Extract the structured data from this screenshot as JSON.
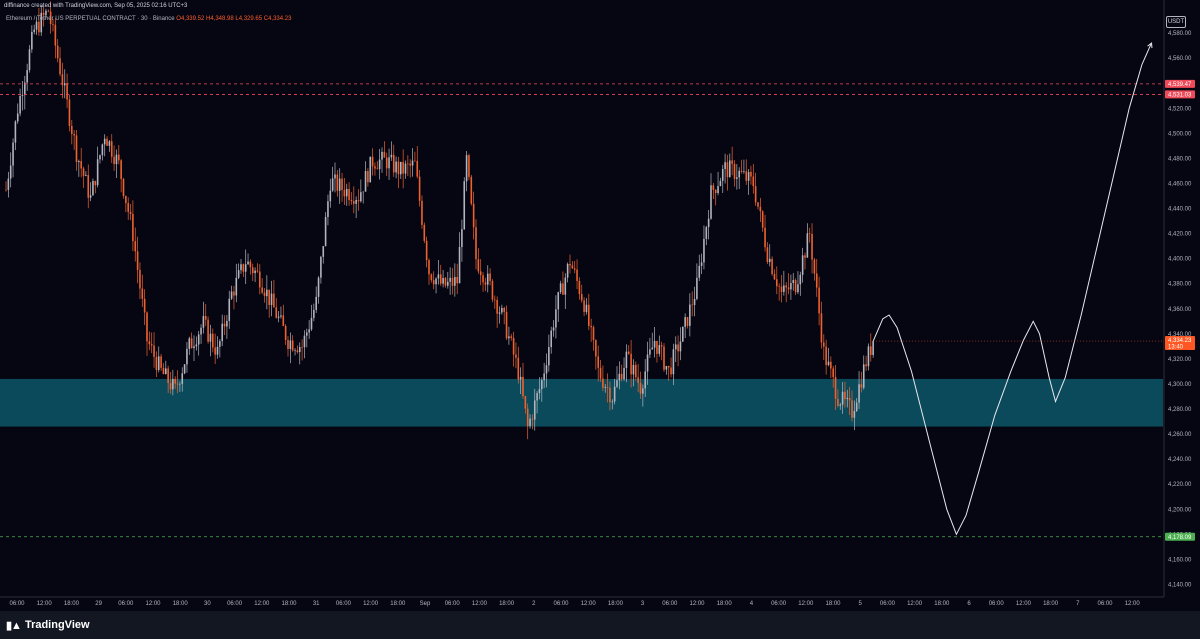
{
  "header": {
    "title": "diffinance created with TradingView.com, Sep 05, 2025 02:16 UTC+3",
    "symbol": "Ethereum / Tether US PERPETUAL CONTRACT · 30 · Binance",
    "ohlc_o": "O4,339.52",
    "ohlc_h": "H4,348.98",
    "ohlc_l": "L4,329.65",
    "ohlc_c": "C4,334.23",
    "unit": "USDT"
  },
  "brand": {
    "name": "TradingView",
    "logo_icon": "tradingview-logo-icon"
  },
  "colors": {
    "background": "#060613",
    "up": "#b2b5be",
    "down": "#f0622d",
    "zone": "#0a4a5a",
    "resistance": "#ef4a5a",
    "support": "#4caf50",
    "price": "#ff5722"
  },
  "chart_data": {
    "type": "bar",
    "ylim": [
      4130,
      4600
    ],
    "y_ticks": [
      4140,
      4160,
      4180,
      4200,
      4220,
      4240,
      4260,
      4280,
      4300,
      4320,
      4340,
      4360,
      4380,
      4400,
      4420,
      4440,
      4460,
      4480,
      4500,
      4520,
      4540,
      4560,
      4580
    ],
    "y_tick_labels": [
      "4,140.00",
      "4,160.00",
      "4,180.00",
      "4,200.00",
      "4,220.00",
      "4,240.00",
      "4,260.00",
      "4,280.00",
      "4,300.00",
      "4,320.00",
      "4,340.00",
      "4,360.00",
      "4,380.00",
      "4,400.00",
      "4,420.00",
      "4,440.00",
      "4,460.00",
      "4,480.00",
      "4,500.00",
      "4,520.00",
      "4,540.00",
      "4,560.00",
      "4,580.00"
    ],
    "x_ticks": [
      "06:00",
      "12:00",
      "18:00",
      "29",
      "06:00",
      "12:00",
      "18:00",
      "30",
      "06:00",
      "12:00",
      "18:00",
      "31",
      "06:00",
      "12:00",
      "18:00",
      "Sep",
      "06:00",
      "12:00",
      "18:00",
      "2",
      "06:00",
      "12:00",
      "18:00",
      "3",
      "06:00",
      "12:00",
      "18:00",
      "4",
      "06:00",
      "12:00",
      "18:00",
      "5",
      "06:00",
      "12:00",
      "18:00",
      "6",
      "06:00",
      "12:00",
      "18:00",
      "7",
      "06:00",
      "12:00"
    ],
    "series_anchors": [
      [
        0,
        4455
      ],
      [
        5,
        4520
      ],
      [
        12,
        4582
      ],
      [
        18,
        4598
      ],
      [
        24,
        4542
      ],
      [
        30,
        4485
      ],
      [
        36,
        4448
      ],
      [
        42,
        4500
      ],
      [
        48,
        4475
      ],
      [
        54,
        4420
      ],
      [
        60,
        4335
      ],
      [
        66,
        4310
      ],
      [
        72,
        4295
      ],
      [
        78,
        4330
      ],
      [
        84,
        4348
      ],
      [
        90,
        4325
      ],
      [
        96,
        4372
      ],
      [
        102,
        4398
      ],
      [
        108,
        4385
      ],
      [
        114,
        4360
      ],
      [
        120,
        4335
      ],
      [
        126,
        4330
      ],
      [
        132,
        4365
      ],
      [
        138,
        4462
      ],
      [
        144,
        4455
      ],
      [
        150,
        4450
      ],
      [
        156,
        4478
      ],
      [
        162,
        4478
      ],
      [
        168,
        4470
      ],
      [
        174,
        4475
      ],
      [
        180,
        4390
      ],
      [
        186,
        4378
      ],
      [
        192,
        4382
      ],
      [
        196,
        4478
      ],
      [
        200,
        4400
      ],
      [
        206,
        4378
      ],
      [
        212,
        4350
      ],
      [
        218,
        4310
      ],
      [
        222,
        4265
      ],
      [
        228,
        4302
      ],
      [
        234,
        4360
      ],
      [
        240,
        4398
      ],
      [
        246,
        4365
      ],
      [
        252,
        4310
      ],
      [
        258,
        4290
      ],
      [
        264,
        4322
      ],
      [
        270,
        4298
      ],
      [
        276,
        4335
      ],
      [
        282,
        4310
      ],
      [
        288,
        4340
      ],
      [
        294,
        4378
      ],
      [
        300,
        4452
      ],
      [
        306,
        4472
      ],
      [
        312,
        4468
      ],
      [
        318,
        4460
      ],
      [
        324,
        4405
      ],
      [
        330,
        4372
      ],
      [
        336,
        4380
      ],
      [
        342,
        4420
      ],
      [
        348,
        4325
      ],
      [
        354,
        4290
      ],
      [
        360,
        4278
      ],
      [
        366,
        4318
      ],
      [
        369,
        4334
      ]
    ],
    "projection": [
      [
        0,
        4334
      ],
      [
        6,
        4352
      ],
      [
        10,
        4355
      ],
      [
        15,
        4345
      ],
      [
        24,
        4310
      ],
      [
        30,
        4280
      ],
      [
        38,
        4240
      ],
      [
        46,
        4200
      ],
      [
        52,
        4180
      ],
      [
        58,
        4195
      ],
      [
        66,
        4230
      ],
      [
        76,
        4275
      ],
      [
        86,
        4310
      ],
      [
        94,
        4335
      ],
      [
        100,
        4350
      ],
      [
        104,
        4340
      ],
      [
        110,
        4305
      ],
      [
        114,
        4286
      ],
      [
        120,
        4305
      ],
      [
        130,
        4355
      ],
      [
        140,
        4410
      ],
      [
        150,
        4465
      ],
      [
        160,
        4520
      ],
      [
        168,
        4555
      ],
      [
        174,
        4572
      ]
    ],
    "zone": [
      4266,
      4304
    ],
    "levels": [
      {
        "name": "resistance-1",
        "value": 4539.47,
        "label": "4,539.47",
        "style": "dashed"
      },
      {
        "name": "resistance-2",
        "value": 4531.03,
        "label": "4,531.03",
        "style": "dashed"
      },
      {
        "name": "support",
        "value": 4178.09,
        "label": "4,178.09",
        "style": "dashed"
      }
    ],
    "last_price": {
      "value": 4334.23,
      "label": "4,334.23",
      "countdown": "13:40"
    }
  }
}
